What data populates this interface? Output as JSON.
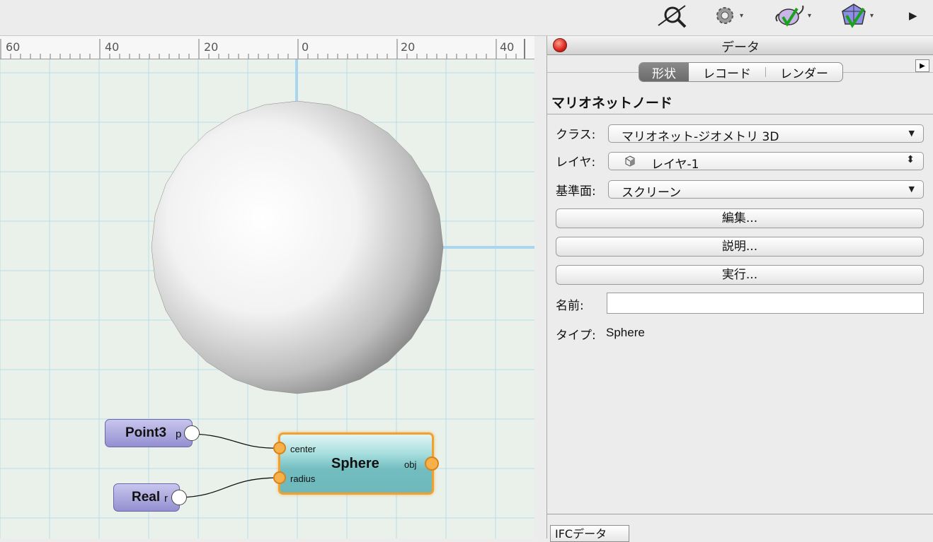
{
  "toolbar": {
    "icons": [
      "magnifier-icon",
      "gear-icon",
      "teapot-check-icon",
      "globe-check-icon",
      "play-icon"
    ],
    "arrow": "▾",
    "more": "▶"
  },
  "ruler": {
    "labels": [
      "60",
      "40",
      "20",
      "0",
      "20",
      "40"
    ]
  },
  "nodes": {
    "point3": {
      "name": "Point3",
      "port": "p"
    },
    "real": {
      "name": "Real",
      "port": "r"
    },
    "sphere": {
      "name": "Sphere",
      "in_center": "center",
      "in_radius": "radius",
      "out": "obj"
    }
  },
  "panel": {
    "title": "データ",
    "tabs": [
      "形状",
      "レコード",
      "レンダー"
    ],
    "menu_arrow": "▶",
    "section_title": "マリオネットノード",
    "class_label": "クラス:",
    "class_value": "マリオネット-ジオメトリ 3D",
    "layer_label": "レイヤ:",
    "layer_value": "レイヤ-1",
    "plane_label": "基準面:",
    "plane_value": "スクリーン",
    "edit_button": "編集...",
    "describe_button": "説明...",
    "run_button": "実行...",
    "name_label": "名前:",
    "name_value": "",
    "type_label": "タイプ:",
    "type_value": "Sphere",
    "ifc_tab": "IFCデータ",
    "dd_arrow": "▼",
    "stepper_arrow": "⬍"
  },
  "colors": {
    "grid_bg": "#e9f1ea",
    "grid_line": "#b9dde9",
    "axis": "#a9d5ee",
    "node_purple": "#a29fd6",
    "node_teal": "#7cc4c6",
    "node_border_selected": "#f0a030"
  }
}
